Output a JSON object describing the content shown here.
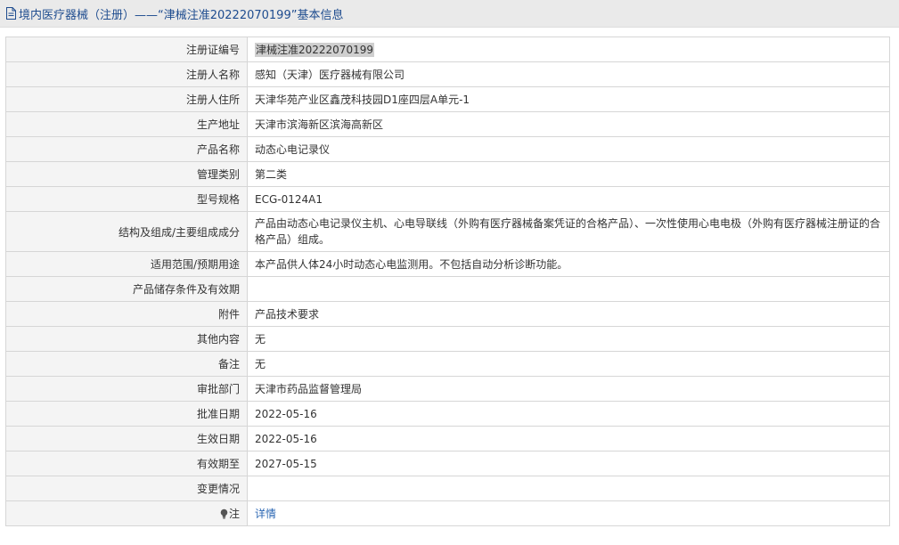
{
  "header": {
    "title": "境内医疗器械（注册）——“津械注准20222070199”基本信息"
  },
  "rows": [
    {
      "label": "注册证编号",
      "value": "津械注准20222070199"
    },
    {
      "label": "注册人名称",
      "value": "感知（天津）医疗器械有限公司"
    },
    {
      "label": "注册人住所",
      "value": "天津华苑产业区鑫茂科技园D1座四层A单元-1"
    },
    {
      "label": "生产地址",
      "value": "天津市滨海新区滨海高新区"
    },
    {
      "label": "产品名称",
      "value": "动态心电记录仪"
    },
    {
      "label": "管理类别",
      "value": "第二类"
    },
    {
      "label": "型号规格",
      "value": "ECG-0124A1"
    },
    {
      "label": "结构及组成/主要组成成分",
      "value": "产品由动态心电记录仪主机、心电导联线（外购有医疗器械备案凭证的合格产品）、一次性使用心电电极（外购有医疗器械注册证的合格产品）组成。"
    },
    {
      "label": "适用范围/预期用途",
      "value": "本产品供人体24小时动态心电监测用。不包括自动分析诊断功能。"
    },
    {
      "label": "产品储存条件及有效期",
      "value": ""
    },
    {
      "label": "附件",
      "value": "产品技术要求"
    },
    {
      "label": "其他内容",
      "value": "无"
    },
    {
      "label": "备注",
      "value": "无"
    },
    {
      "label": "审批部门",
      "value": "天津市药品监督管理局"
    },
    {
      "label": "批准日期",
      "value": "2022-05-16"
    },
    {
      "label": "生效日期",
      "value": "2022-05-16"
    },
    {
      "label": "有效期至",
      "value": "2027-05-15"
    },
    {
      "label": "变更情况",
      "value": ""
    },
    {
      "label": "注",
      "value": "详情"
    }
  ]
}
